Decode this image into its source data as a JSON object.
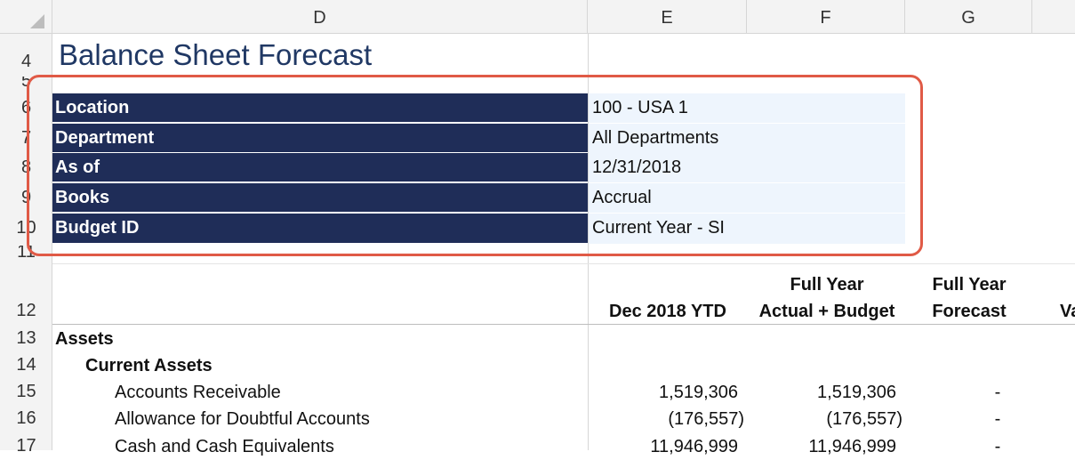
{
  "columns": [
    "D",
    "E",
    "F",
    "G"
  ],
  "rows": [
    "4",
    "5",
    "6",
    "7",
    "8",
    "9",
    "10",
    "11",
    "12",
    "13",
    "14",
    "15",
    "16",
    "17"
  ],
  "title": "Balance Sheet Forecast",
  "params": [
    {
      "label": "Location",
      "value": "100 - USA 1"
    },
    {
      "label": "Department",
      "value": "All Departments"
    },
    {
      "label": "As of",
      "value": "12/31/2018"
    },
    {
      "label": "Books",
      "value": "Accrual"
    },
    {
      "label": "Budget ID",
      "value": "Current Year - SI"
    }
  ],
  "headers": {
    "e": "Dec 2018 YTD",
    "f_line1": "Full Year",
    "f_line2": "Actual + Budget",
    "g_line1": "Full Year",
    "g_line2": "Forecast",
    "h_partial": "Va"
  },
  "section_assets": "Assets",
  "section_current_assets": "Current Assets",
  "accounts": [
    {
      "name": "Accounts Receivable",
      "e": "1,519,306",
      "f": "1,519,306",
      "g": "-"
    },
    {
      "name": "Allowance for Doubtful Accounts",
      "e": "(176,557)",
      "f": "(176,557)",
      "g": "-"
    },
    {
      "name": "Cash and Cash Equivalents",
      "e": "11,946,999",
      "f": "11,946,999",
      "g": "-"
    }
  ],
  "colors": {
    "header_fill": "#1f2d58",
    "value_fill": "#eef5fd",
    "highlight": "#e05a46",
    "title": "#203864"
  }
}
